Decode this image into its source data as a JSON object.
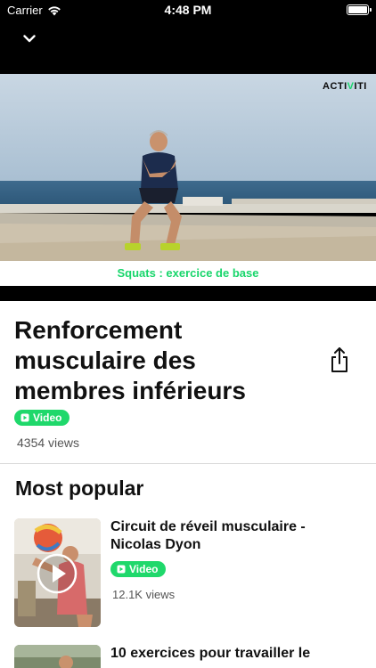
{
  "status_bar": {
    "carrier": "Carrier",
    "time": "4:48 PM"
  },
  "video": {
    "caption": "Squats : exercice de base",
    "brand_prefix": "ACTI",
    "brand_accent": "V",
    "brand_suffix": "ITI"
  },
  "content": {
    "title": "Renforcement musculaire des membres inférieurs",
    "badge": "Video",
    "views": "4354 views"
  },
  "section": {
    "title": "Most popular"
  },
  "items": [
    {
      "title": "Circuit de réveil musculaire - Nicolas Dyon",
      "badge": "Video",
      "views": "12.1K views"
    },
    {
      "title": "10 exercices pour travailler le"
    }
  ],
  "colors": {
    "accent": "#1fd86b",
    "caption": "#18d66b",
    "background": "#ffffff",
    "bar": "#000000"
  }
}
